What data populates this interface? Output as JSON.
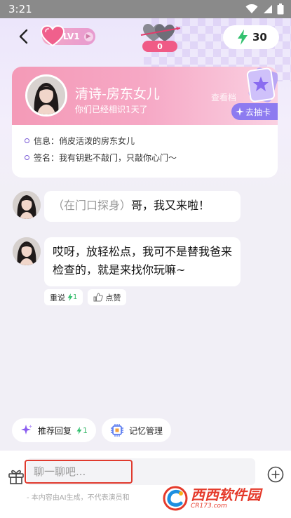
{
  "status_bar": {
    "time": "3:21"
  },
  "header": {
    "level": "LV1",
    "heart_count": "0",
    "energy": "30"
  },
  "profile": {
    "name": "清诗-房东女儿",
    "since": "你们已经相识1天了",
    "view_more": "查看档",
    "gacha_label": "去抽卡",
    "info_label": "信息",
    "info_value": "俏皮活泼的房东女儿",
    "sign_label": "签名",
    "sign_value": "我有钥匙不敲门，只敲你心门～"
  },
  "messages": [
    {
      "action": "（在门口探身）",
      "text": "哥，我又来啦！"
    },
    {
      "text": "哎呀，放轻松点，我可不是替我爸来检查的，就是来找你玩嘛~"
    }
  ],
  "message_actions": {
    "redo_label": "重说",
    "redo_cost": "1",
    "like_label": "点赞"
  },
  "quick_actions": {
    "suggest_label": "推荐回复",
    "suggest_cost": "1",
    "memory_label": "记忆管理"
  },
  "composer": {
    "placeholder": "聊一聊吧...",
    "disclaimer": "- 本内容由AI生成，不代表演员和"
  },
  "watermark": {
    "title": "西西软件园",
    "url": "CR173.com"
  },
  "colors": {
    "accent": "#8d7bf0",
    "pink": "#f49ab7",
    "energy": "#3bb86b",
    "highlight": "#e03a2e"
  }
}
